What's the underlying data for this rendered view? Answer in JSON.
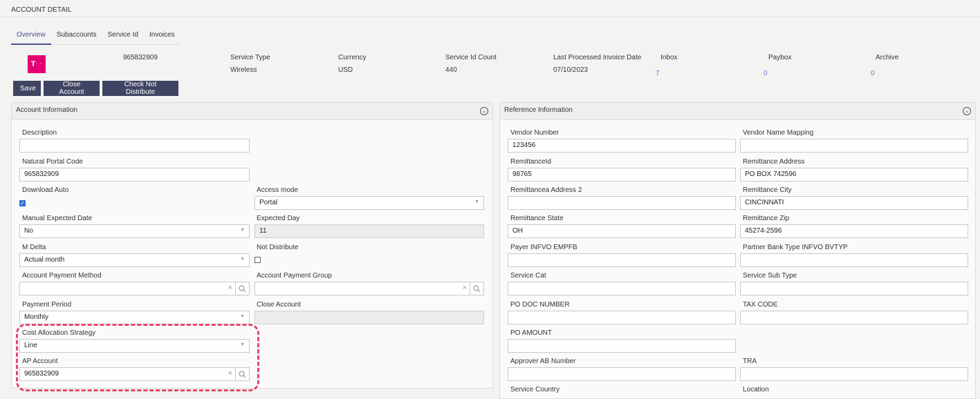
{
  "page": {
    "title": "ACCOUNT DETAIL"
  },
  "tabs": [
    {
      "label": "Overview",
      "active": true
    },
    {
      "label": "Subaccounts"
    },
    {
      "label": "Service Id"
    },
    {
      "label": "Invoices"
    }
  ],
  "logo": {
    "letter": "T",
    "dots": "· ·",
    "color": "#e20074"
  },
  "summary": {
    "account_number": "965832909",
    "service_type": {
      "label": "Service Type",
      "value": "Wireless"
    },
    "currency": {
      "label": "Currency",
      "value": "USD"
    },
    "service_id_count": {
      "label": "Service Id Count",
      "value": "440"
    },
    "last_processed": {
      "label": "Last Processed Invoice Date",
      "value": "07/10/2023"
    },
    "inbox": {
      "label": "Inbox",
      "value": "7"
    },
    "paybox": {
      "label": "Paybox",
      "value": "0"
    },
    "archive": {
      "label": "Archive",
      "value": "0"
    }
  },
  "toolbar": {
    "save_label": "Save",
    "close_account_label": "Close Account",
    "check_not_distribute_label": "Check Not Distribute"
  },
  "account_info": {
    "title": "Account Information",
    "description": {
      "label": "Description",
      "value": ""
    },
    "natural_portal_code": {
      "label": "Natural Portal Code",
      "value": "965832909"
    },
    "download_auto": {
      "label": "Download Auto",
      "checked": true
    },
    "access_mode": {
      "label": "Access mode",
      "value": "Portal"
    },
    "manual_expected_date": {
      "label": "Manual Expected Date",
      "value": "No"
    },
    "expected_day": {
      "label": "Expected Day",
      "value": "11"
    },
    "m_delta": {
      "label": "M Delta",
      "value": "Actual month"
    },
    "not_distribute": {
      "label": "Not Distribute",
      "checked": false
    },
    "account_payment_method": {
      "label": "Account Payment Method",
      "value": ""
    },
    "account_payment_group": {
      "label": "Account Payment Group",
      "value": ""
    },
    "payment_period": {
      "label": "Payment Period",
      "value": "Monthly"
    },
    "close_account": {
      "label": "Close Account",
      "value": ""
    },
    "cost_allocation_strategy": {
      "label": "Cost Allocation Strategy",
      "value": "Line"
    },
    "ap_account": {
      "label": "AP Account",
      "value": "965832909"
    }
  },
  "reference_info": {
    "title": "Reference Information",
    "vendor_number": {
      "label": "Vendor Number",
      "value": "123456"
    },
    "vendor_name_mapping": {
      "label": "Vendor Name Mapping",
      "value": ""
    },
    "remittance_id": {
      "label": "RemittanceId",
      "value": "98765"
    },
    "remittance_address": {
      "label": "Remittance Address",
      "value": "PO BOX 742596"
    },
    "remittance_address_2": {
      "label": "Remittancea Address 2",
      "value": ""
    },
    "remittance_city": {
      "label": "Remittance City",
      "value": "CINCINNATI"
    },
    "remittance_state": {
      "label": "Remittance State",
      "value": "OH"
    },
    "remittance_zip": {
      "label": "Remittance Zip",
      "value": "45274-2596"
    },
    "payer_infvo": {
      "label": "Payer INFVO EMPFB",
      "value": ""
    },
    "partner_bank_type": {
      "label": "Partner Bank Type INFVO BVTYP",
      "value": ""
    },
    "service_cat": {
      "label": "Service Cat",
      "value": ""
    },
    "service_sub_type": {
      "label": "Service Sub Type",
      "value": ""
    },
    "po_doc_number": {
      "label": "PO DOC NUMBER",
      "value": ""
    },
    "tax_code": {
      "label": "TAX CODE",
      "value": ""
    },
    "po_amount": {
      "label": "PO AMOUNT",
      "value": ""
    },
    "approver_ab_number": {
      "label": "Approver AB Number",
      "value": ""
    },
    "tra": {
      "label": "TRA",
      "value": ""
    },
    "service_country": {
      "label": "Service Country"
    },
    "location": {
      "label": "Location"
    }
  },
  "icons": {
    "collapse": "chevron-circle-down",
    "clear": "×",
    "search": "magnifier",
    "caret": "▼"
  }
}
